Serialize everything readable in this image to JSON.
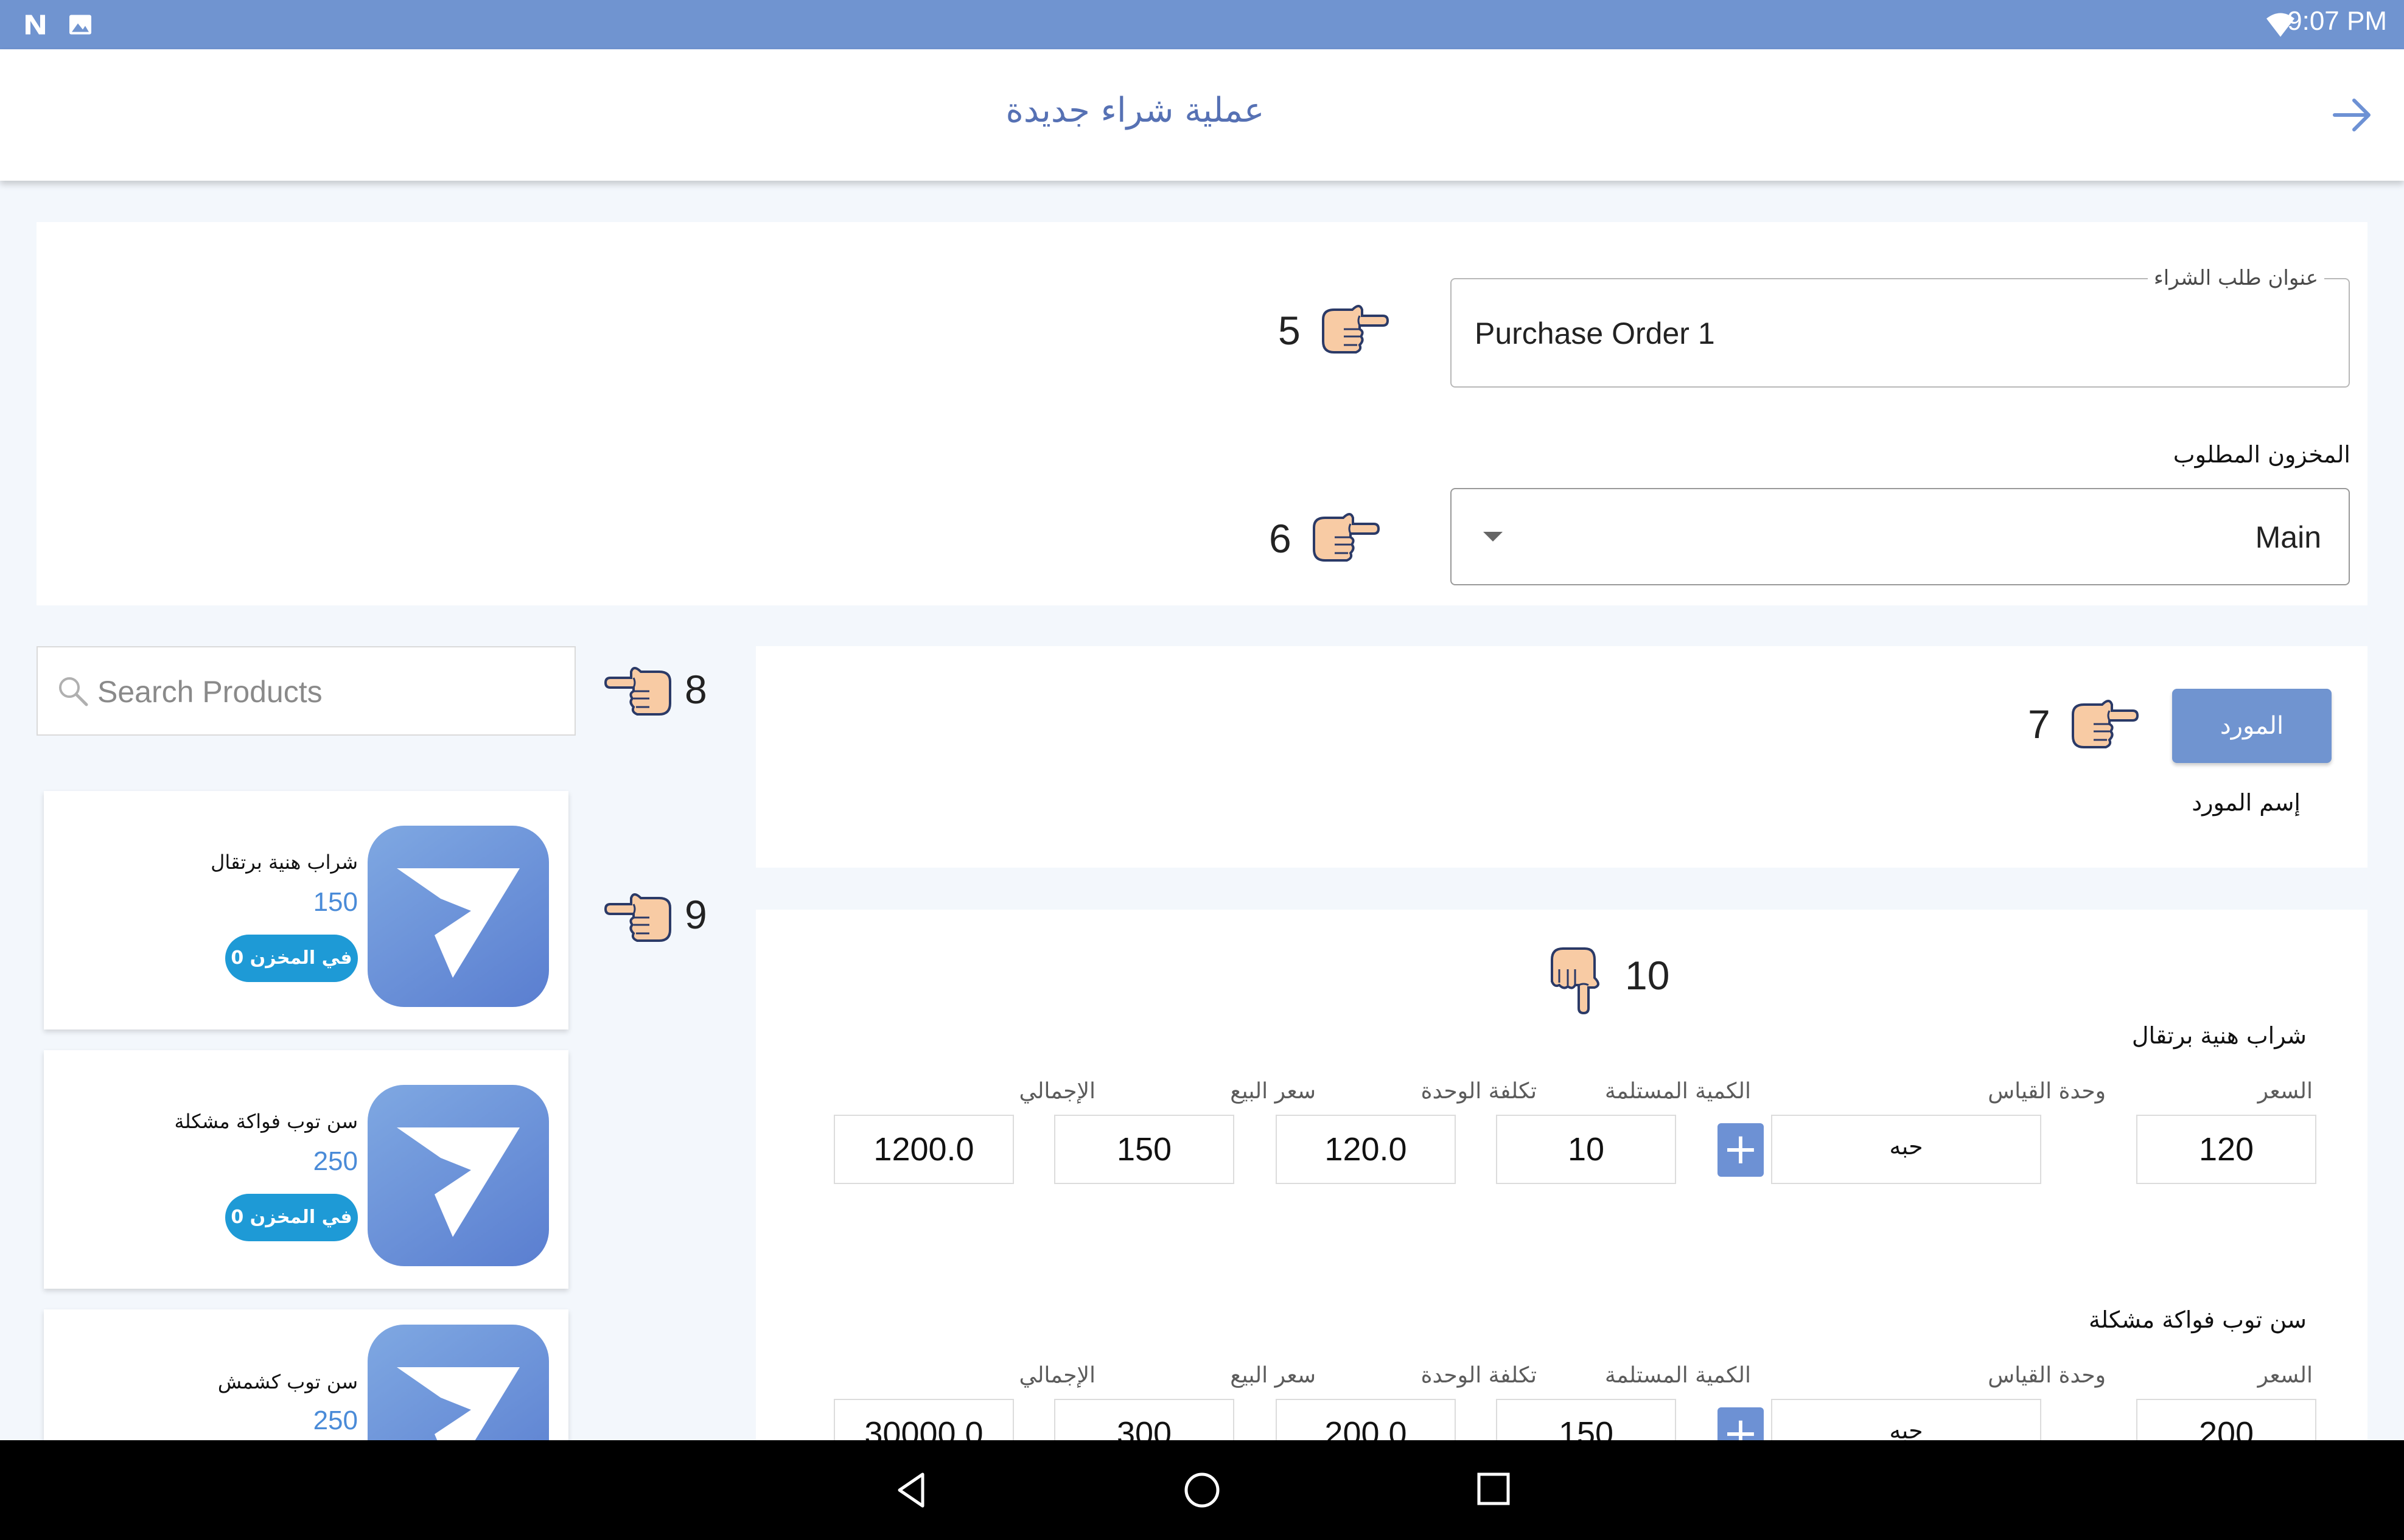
{
  "status_bar": {
    "time": "9:07 PM",
    "icons": [
      "notification-n-icon",
      "image-icon",
      "wifi-icon"
    ]
  },
  "app_bar": {
    "title": "عملية شراء جديدة",
    "back_icon": "arrow-right-icon"
  },
  "form": {
    "purchase_title": {
      "label": "عنوان طلب الشراء",
      "value": "Purchase Order 1",
      "hint": "5"
    },
    "warehouse": {
      "label": "المخزون المطلوب",
      "value": "Main",
      "hint": "6"
    }
  },
  "supplier": {
    "button_label": "المورد",
    "name_label": "إسم المورد",
    "hint": "7"
  },
  "search": {
    "placeholder": "Search Products",
    "hint": "8"
  },
  "products": [
    {
      "name": "شراب هنية برتقال",
      "price": "150",
      "stock": "0 في المخزن"
    },
    {
      "name": "سن توب فواكة مشكلة",
      "price": "250",
      "stock": "0 في المخزن"
    },
    {
      "name": "سن توب كشمش",
      "price": "250"
    }
  ],
  "products_hint": "9",
  "items_hint": "10",
  "columns": {
    "price": "السعر",
    "unit": "وحدة القياس",
    "received_qty": "الكمية المستلمة",
    "unit_cost": "تكلفة الوحدة",
    "sell_price": "سعر البيع",
    "total": "الإجمالي"
  },
  "items": [
    {
      "name": "شراب هنية برتقال",
      "price": "120",
      "unit": "حبه",
      "received_qty": "10",
      "unit_cost": "120.0",
      "sell_price": "150",
      "total": "1200.0"
    },
    {
      "name": "سن توب فواكة مشكلة",
      "price": "200",
      "unit": "حبه",
      "received_qty": "150",
      "unit_cost": "200.0",
      "sell_price": "300",
      "total": "30000.0"
    }
  ],
  "colors": {
    "accent": "#7094d0",
    "title": "#5671b4",
    "badge": "#1e9ad6",
    "price": "#4a8bd8"
  }
}
